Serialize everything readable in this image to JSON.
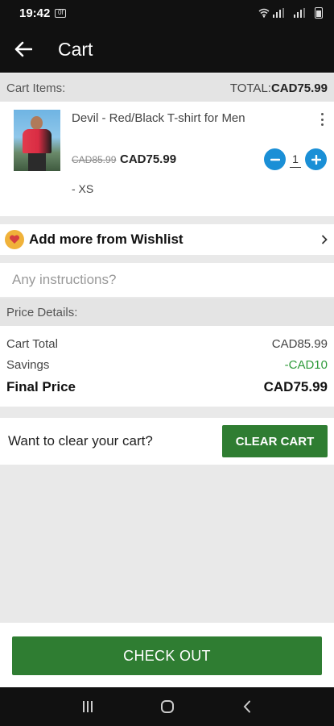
{
  "status_bar": {
    "time": "19:42",
    "notification_badge": "0f"
  },
  "app_bar": {
    "title": "Cart"
  },
  "cart_items_header": {
    "label": "Cart Items:",
    "total_label": "TOTAL:",
    "total_value": "CAD75.99"
  },
  "cart_item": {
    "name": "Devil - Red/Black T-shirt for Men",
    "old_price": "CAD85.99",
    "price": "CAD75.99",
    "quantity": "1",
    "variant": "- XS"
  },
  "wishlist": {
    "label": "Add more from Wishlist"
  },
  "instructions": {
    "placeholder": "Any instructions?"
  },
  "price_details": {
    "header": "Price Details:",
    "cart_total_label": "Cart Total",
    "cart_total_value": "CAD85.99",
    "savings_label": "Savings",
    "savings_value": "-CAD10",
    "final_label": "Final Price",
    "final_value": "CAD75.99"
  },
  "clear_cart": {
    "question": "Want to clear your cart?",
    "button": "CLEAR CART"
  },
  "checkout": {
    "button": "CHECK OUT"
  },
  "colors": {
    "primary_green": "#2f7d32",
    "qty_blue": "#1a8fd6",
    "savings_green": "#2e9a3a",
    "bar_black": "#111111"
  }
}
